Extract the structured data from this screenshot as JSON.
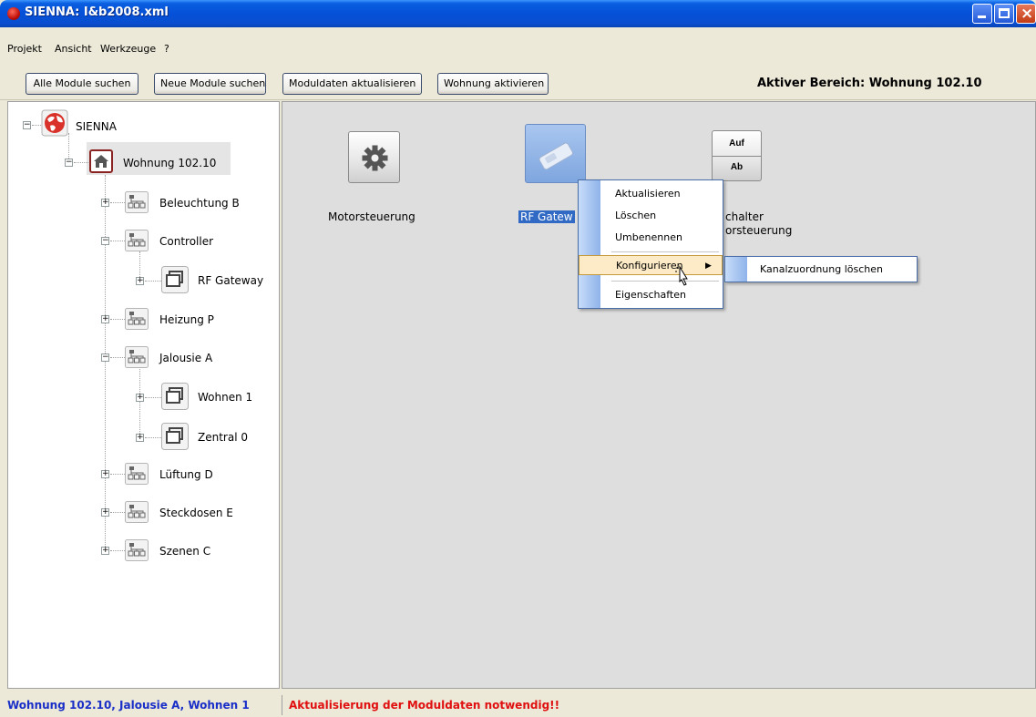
{
  "window": {
    "title": "SIENNA: I&b2008.xml"
  },
  "menu": [
    "Projekt",
    "Ansicht",
    "Werkzeuge",
    "?"
  ],
  "toolbar": {
    "buttons": [
      "Alle Module suchen",
      "Neue Module suchen",
      "Moduldaten aktualisieren",
      "Wohnung aktivieren"
    ],
    "active_area": "Aktiver Bereich: Wohnung 102.10"
  },
  "tree": {
    "root": "SIENNA",
    "wohnung": "Wohnung 102.10",
    "nodes": [
      "Beleuchtung B",
      "Controller",
      "RF Gateway",
      "Heizung P",
      "Jalousie A",
      "Wohnen 1",
      "Zentral 0",
      "Lüftung D",
      "Steckdosen E",
      "Szenen C"
    ]
  },
  "modules": {
    "motor": "Motorsteuerung",
    "rf": "RF Gatew",
    "schalter_line1": "chalter",
    "schalter_line2": "orsteuerung",
    "auf": "Auf",
    "ab": "Ab"
  },
  "context_menu": {
    "items": [
      "Aktualisieren",
      "Löschen",
      "Umbenennen",
      "Konfigurieren",
      "Eigenschaften"
    ],
    "submenu": "Kanalzuordnung löschen"
  },
  "status": {
    "left": "Wohnung 102.10, Jalousie A, Wohnen 1",
    "right": "Aktualisierung der Moduldaten notwendig!!"
  }
}
